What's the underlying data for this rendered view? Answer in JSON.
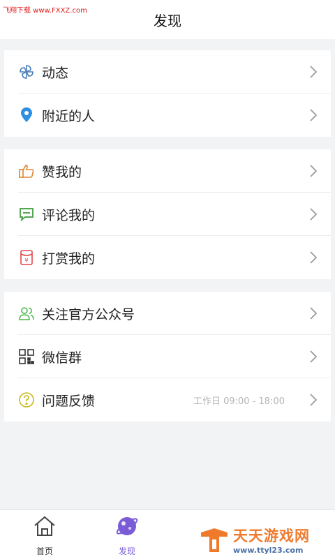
{
  "watermark": {
    "top_left": "飞翔下载 www.FXXZ.com"
  },
  "header": {
    "title": "发现"
  },
  "groups": [
    {
      "items": [
        {
          "label": "动态",
          "icon": "pinwheel-icon"
        },
        {
          "label": "附近的人",
          "icon": "location-pin-icon"
        }
      ]
    },
    {
      "items": [
        {
          "label": "赞我的",
          "icon": "thumbs-up-icon"
        },
        {
          "label": "评论我的",
          "icon": "comment-icon"
        },
        {
          "label": "打赏我的",
          "icon": "red-envelope-icon"
        }
      ]
    },
    {
      "items": [
        {
          "label": "关注官方公众号",
          "icon": "users-icon"
        },
        {
          "label": "微信群",
          "icon": "qr-code-icon"
        },
        {
          "label": "问题反馈",
          "icon": "help-icon",
          "sub": "工作日 09:00 - 18:00"
        }
      ]
    }
  ],
  "tabbar": {
    "tabs": [
      {
        "label": "首页",
        "icon": "home-icon",
        "active": false
      },
      {
        "label": "发现",
        "icon": "discover-planet-icon",
        "active": true
      }
    ]
  },
  "brand": {
    "name": "天天游戏网",
    "url": "www.ttyl23.com"
  },
  "colors": {
    "active_tab": "#7b5cd6",
    "brand_orange": "#f07a2c",
    "watermark_red": "#e02020"
  }
}
